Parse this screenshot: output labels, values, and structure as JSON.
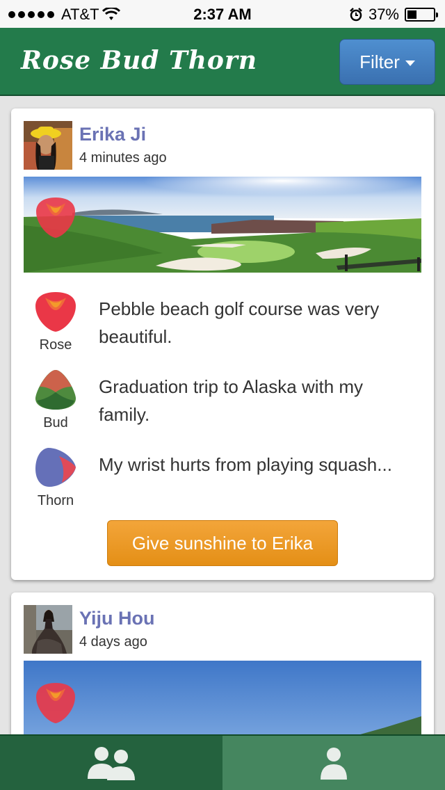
{
  "status_bar": {
    "carrier": "AT&T",
    "time": "2:37 AM",
    "battery": "37%",
    "battery_level": 0.37
  },
  "navbar": {
    "brand": "Rose Bud Thorn",
    "filter_label": "Filter"
  },
  "posts": [
    {
      "user": "Erika Ji",
      "time_ago": "4 minutes ago",
      "entries": [
        {
          "kind": "Rose",
          "text": "Pebble beach golf course was very beautiful."
        },
        {
          "kind": "Bud",
          "text": "Graduation trip to Alaska with my family."
        },
        {
          "kind": "Thorn",
          "text": "My wrist hurts from playing squash..."
        }
      ],
      "action_label": "Give sunshine to Erika"
    },
    {
      "user": "Yiju Hou",
      "time_ago": "4 days ago"
    }
  ],
  "tabbar": {
    "tabs": [
      {
        "icon": "friends-icon",
        "active": true
      },
      {
        "icon": "profile-icon",
        "active": false
      }
    ]
  },
  "colors": {
    "brand_green": "#237b4b",
    "filter_blue": "#4a86c6",
    "sunshine_orange": "#f0a030",
    "username_purple": "#6a72b4"
  }
}
